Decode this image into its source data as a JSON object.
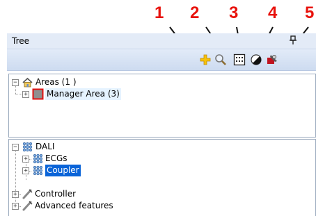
{
  "callouts": [
    "1",
    "2",
    "3",
    "4",
    "5"
  ],
  "panel": {
    "title": "Tree",
    "pin_glyph": "↑"
  },
  "toolbar": {
    "buttons": [
      {
        "icon": "add-icon",
        "color": "#f3b400"
      },
      {
        "icon": "search-icon",
        "color": "#8a8a8a"
      },
      {
        "icon": "grid-icon",
        "color": "#000000"
      },
      {
        "icon": "contrast-icon",
        "color": "#000000"
      },
      {
        "icon": "pin-tool-icon",
        "color": "#c0131f"
      }
    ]
  },
  "areas_tree": {
    "root": {
      "label": "Areas (1 )",
      "expander": "−"
    },
    "child": {
      "label": "Manager Area (3)",
      "expander": "+"
    }
  },
  "dali_tree": {
    "root": {
      "label": "DALI",
      "expander": "−"
    },
    "items": [
      {
        "label": "ECGs",
        "expander": "+"
      },
      {
        "label": "Coupler",
        "expander": "+",
        "selected": true
      },
      {
        "label": "Controller",
        "expander": "+"
      },
      {
        "label": "Advanced features",
        "expander": "+"
      }
    ]
  },
  "colors": {
    "callout": "#e8120c",
    "selection": "#0a64d8",
    "toolbar": "#d6e2f4"
  }
}
